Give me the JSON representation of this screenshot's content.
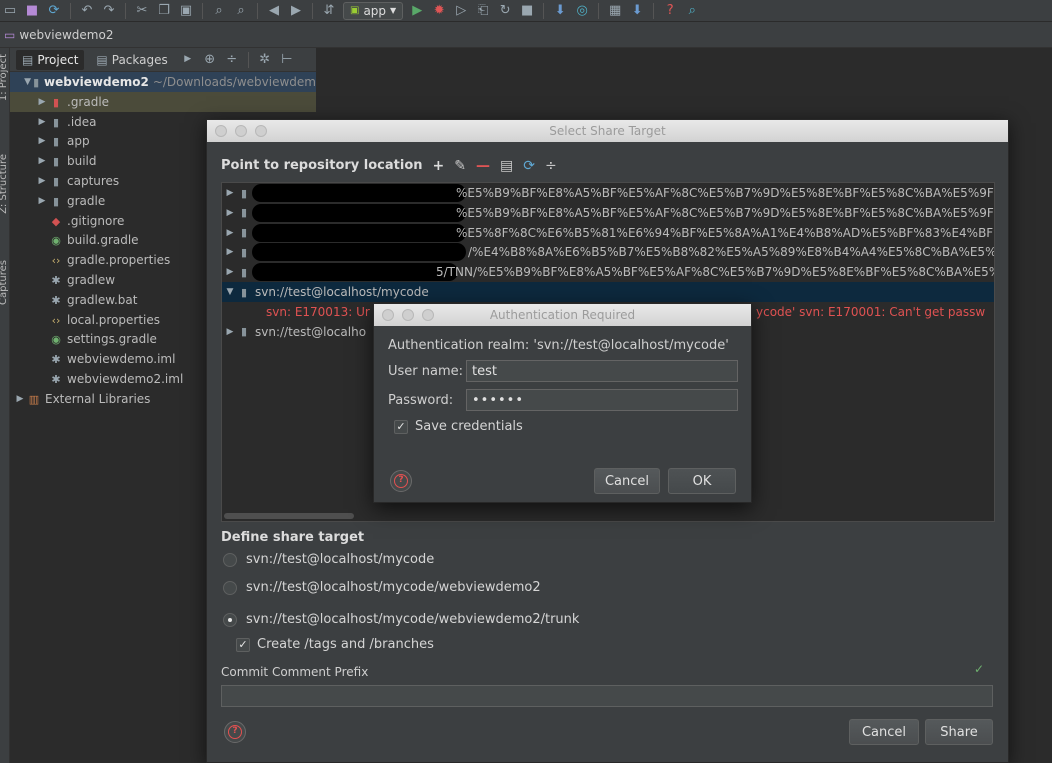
{
  "toolbar": {
    "run_config": "app",
    "icons": [
      "folder-icon",
      "save-icon",
      "sync-icon",
      "undo-icon",
      "redo-icon",
      "cut-icon",
      "copy-icon",
      "paste-icon",
      "find-icon",
      "replace-icon",
      "back-icon",
      "forward-icon",
      "make-icon",
      "run-icon",
      "debug-icon",
      "profile-icon",
      "attach-icon",
      "stop-icon",
      "sdk-manager-icon",
      "avd-manager-icon",
      "structure-icon",
      "build-variants-icon",
      "help-icon",
      "search-icon"
    ]
  },
  "navbar": {
    "project": "webviewdemo2"
  },
  "left_strip": {
    "tabs": [
      "1: Project",
      "Z: Structure",
      "Captures"
    ]
  },
  "project_panel": {
    "tabs": [
      "Project",
      "Packages"
    ],
    "root": {
      "name": "webviewdemo2",
      "path": "~/Downloads/webviewdem"
    },
    "items": [
      {
        "label": ".gradle",
        "kind": "folder",
        "expandable": true
      },
      {
        "label": ".idea",
        "kind": "folder",
        "expandable": true
      },
      {
        "label": "app",
        "kind": "module",
        "expandable": true
      },
      {
        "label": "build",
        "kind": "folder",
        "expandable": true
      },
      {
        "label": "captures",
        "kind": "folder",
        "expandable": true
      },
      {
        "label": "gradle",
        "kind": "folder",
        "expandable": true
      },
      {
        "label": ".gitignore",
        "kind": "git",
        "expandable": false
      },
      {
        "label": "build.gradle",
        "kind": "gradle",
        "expandable": false
      },
      {
        "label": "gradle.properties",
        "kind": "xml",
        "expandable": false
      },
      {
        "label": "gradlew",
        "kind": "props",
        "expandable": false
      },
      {
        "label": "gradlew.bat",
        "kind": "props",
        "expandable": false
      },
      {
        "label": "local.properties",
        "kind": "xml",
        "expandable": false
      },
      {
        "label": "settings.gradle",
        "kind": "gradle",
        "expandable": false
      },
      {
        "label": "webviewdemo.iml",
        "kind": "props",
        "expandable": false
      },
      {
        "label": "webviewdemo2.iml",
        "kind": "props",
        "expandable": false
      }
    ],
    "external": "External Libraries"
  },
  "share_dialog": {
    "title": "Select Share Target",
    "repo_header": "Point to repository location",
    "repo_rows": [
      "%E5%B9%BF%E8%A5%BF%E5%AF%8C%E5%B7%9D%E5%8E%BF%E5%8C%BA%E5%9F%9F%E",
      "%E5%B9%BF%E8%A5%BF%E5%AF%8C%E5%B7%9D%E5%8E%BF%E5%8C%BA%E5%9F%9F%E",
      "%E5%8F%8C%E6%B5%81%E6%94%BF%E5%8A%A1%E4%B8%AD%E5%BF%83%E4%BF%A1%",
      "/%E4%B8%8A%E6%B5%B7%E5%B8%82%E5%A5%89%E8%B4%A4%E5%8C%BA%E5%8D%",
      "5/TNN/%E5%B9%BF%E8%A5%BF%E5%AF%8C%E5%B7%9D%E5%8E%BF%E5%8C%BA%E5%9F%"
    ],
    "selected_repo": "svn://test@localhost/mycode",
    "error_left": "svn: E170013: Ur",
    "error_right": "ycode' svn: E170001: Can't get passw",
    "second_repo": "svn://test@localho",
    "define_title": "Define share target",
    "targets": [
      {
        "label": "svn://test@localhost/mycode",
        "selected": false
      },
      {
        "label": "svn://test@localhost/mycode/webviewdemo2",
        "selected": false
      },
      {
        "label": "svn://test@localhost/mycode/webviewdemo2/trunk",
        "selected": true
      }
    ],
    "create_tags_label": "Create /tags and /branches",
    "create_tags_checked": true,
    "prefix_label": "Commit Comment Prefix",
    "prefix_value": "",
    "cancel": "Cancel",
    "share": "Share"
  },
  "auth_dialog": {
    "title": "Authentication Required",
    "realm": "Authentication realm: 'svn://test@localhost/mycode'",
    "user_label": "User name:",
    "user_value": "test",
    "password_label": "Password:",
    "password_value": "••••••",
    "save_label": "Save credentials",
    "save_checked": true,
    "cancel": "Cancel",
    "ok": "OK"
  }
}
